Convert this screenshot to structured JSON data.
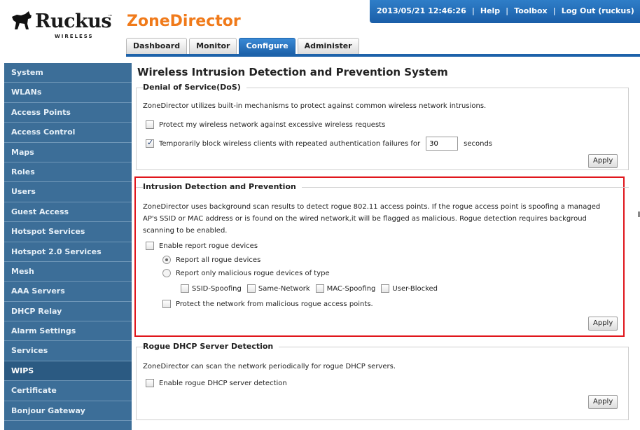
{
  "brand": {
    "logo_text": "Ruckus",
    "logo_tm": "™",
    "logo_sub": "WIRELESS",
    "app_title": "ZoneDirector",
    "brand_color": "#f07a1a"
  },
  "topbar": {
    "datetime": "2013/05/21 12:46:26",
    "help": "Help",
    "toolbox": "Toolbox",
    "logout": "Log Out (ruckus)",
    "separator": "|"
  },
  "tabs": [
    {
      "label": "Dashboard",
      "active": false
    },
    {
      "label": "Monitor",
      "active": false
    },
    {
      "label": "Configure",
      "active": true
    },
    {
      "label": "Administer",
      "active": false
    }
  ],
  "sidebar": {
    "items": [
      {
        "label": "System"
      },
      {
        "label": "WLANs"
      },
      {
        "label": "Access Points"
      },
      {
        "label": "Access Control"
      },
      {
        "label": "Maps"
      },
      {
        "label": "Roles"
      },
      {
        "label": "Users"
      },
      {
        "label": "Guest Access"
      },
      {
        "label": "Hotspot Services"
      },
      {
        "label": "Hotspot 2.0 Services"
      },
      {
        "label": "Mesh"
      },
      {
        "label": "AAA Servers"
      },
      {
        "label": "DHCP Relay"
      },
      {
        "label": "Alarm Settings"
      },
      {
        "label": "Services"
      },
      {
        "label": "WIPS",
        "active": true
      },
      {
        "label": "Certificate"
      },
      {
        "label": "Bonjour Gateway"
      }
    ]
  },
  "main": {
    "title": "Wireless Intrusion Detection and Prevention System",
    "dos": {
      "title": "Denial of Service(DoS)",
      "description": "ZoneDirector utilizes built-in mechanisms to protect against common wireless network intrusions.",
      "protect_label": "Protect my wireless network against excessive wireless requests",
      "protect_checked": false,
      "block_label": "Temporarily block wireless clients with repeated authentication failures for",
      "block_checked": true,
      "block_value": "30",
      "block_unit": "seconds",
      "apply": "Apply"
    },
    "idp": {
      "title": "Intrusion Detection and Prevention",
      "description_lines": [
        "ZoneDirector uses background scan results to detect rogue 802.11 access points. If the rogue access point is spoofing a managed",
        "AP's SSID or MAC address or is found on the wired network,it will be flagged as malicious. Rogue detection requires backgroud",
        "scanning to be enabled."
      ],
      "enable_label": "Enable report rogue devices",
      "enable_checked": false,
      "report_all_label": "Report all rogue devices",
      "report_all_selected": true,
      "report_malicious_label": "Report only malicious rogue devices of type",
      "report_malicious_selected": false,
      "types": [
        {
          "label": "SSID-Spoofing",
          "checked": false
        },
        {
          "label": "Same-Network",
          "checked": false
        },
        {
          "label": "MAC-Spoofing",
          "checked": false
        },
        {
          "label": "User-Blocked",
          "checked": false
        }
      ],
      "protect_label": "Protect the network from malicious rogue access points.",
      "protect_checked": false,
      "apply": "Apply",
      "highlight_color": "#e0161c"
    },
    "dhcp": {
      "title": "Rogue DHCP Server Detection",
      "description": "ZoneDirector can scan the network periodically for rogue DHCP servers.",
      "enable_label": "Enable rogue DHCP server detection",
      "enable_checked": false,
      "apply": "Apply"
    }
  }
}
